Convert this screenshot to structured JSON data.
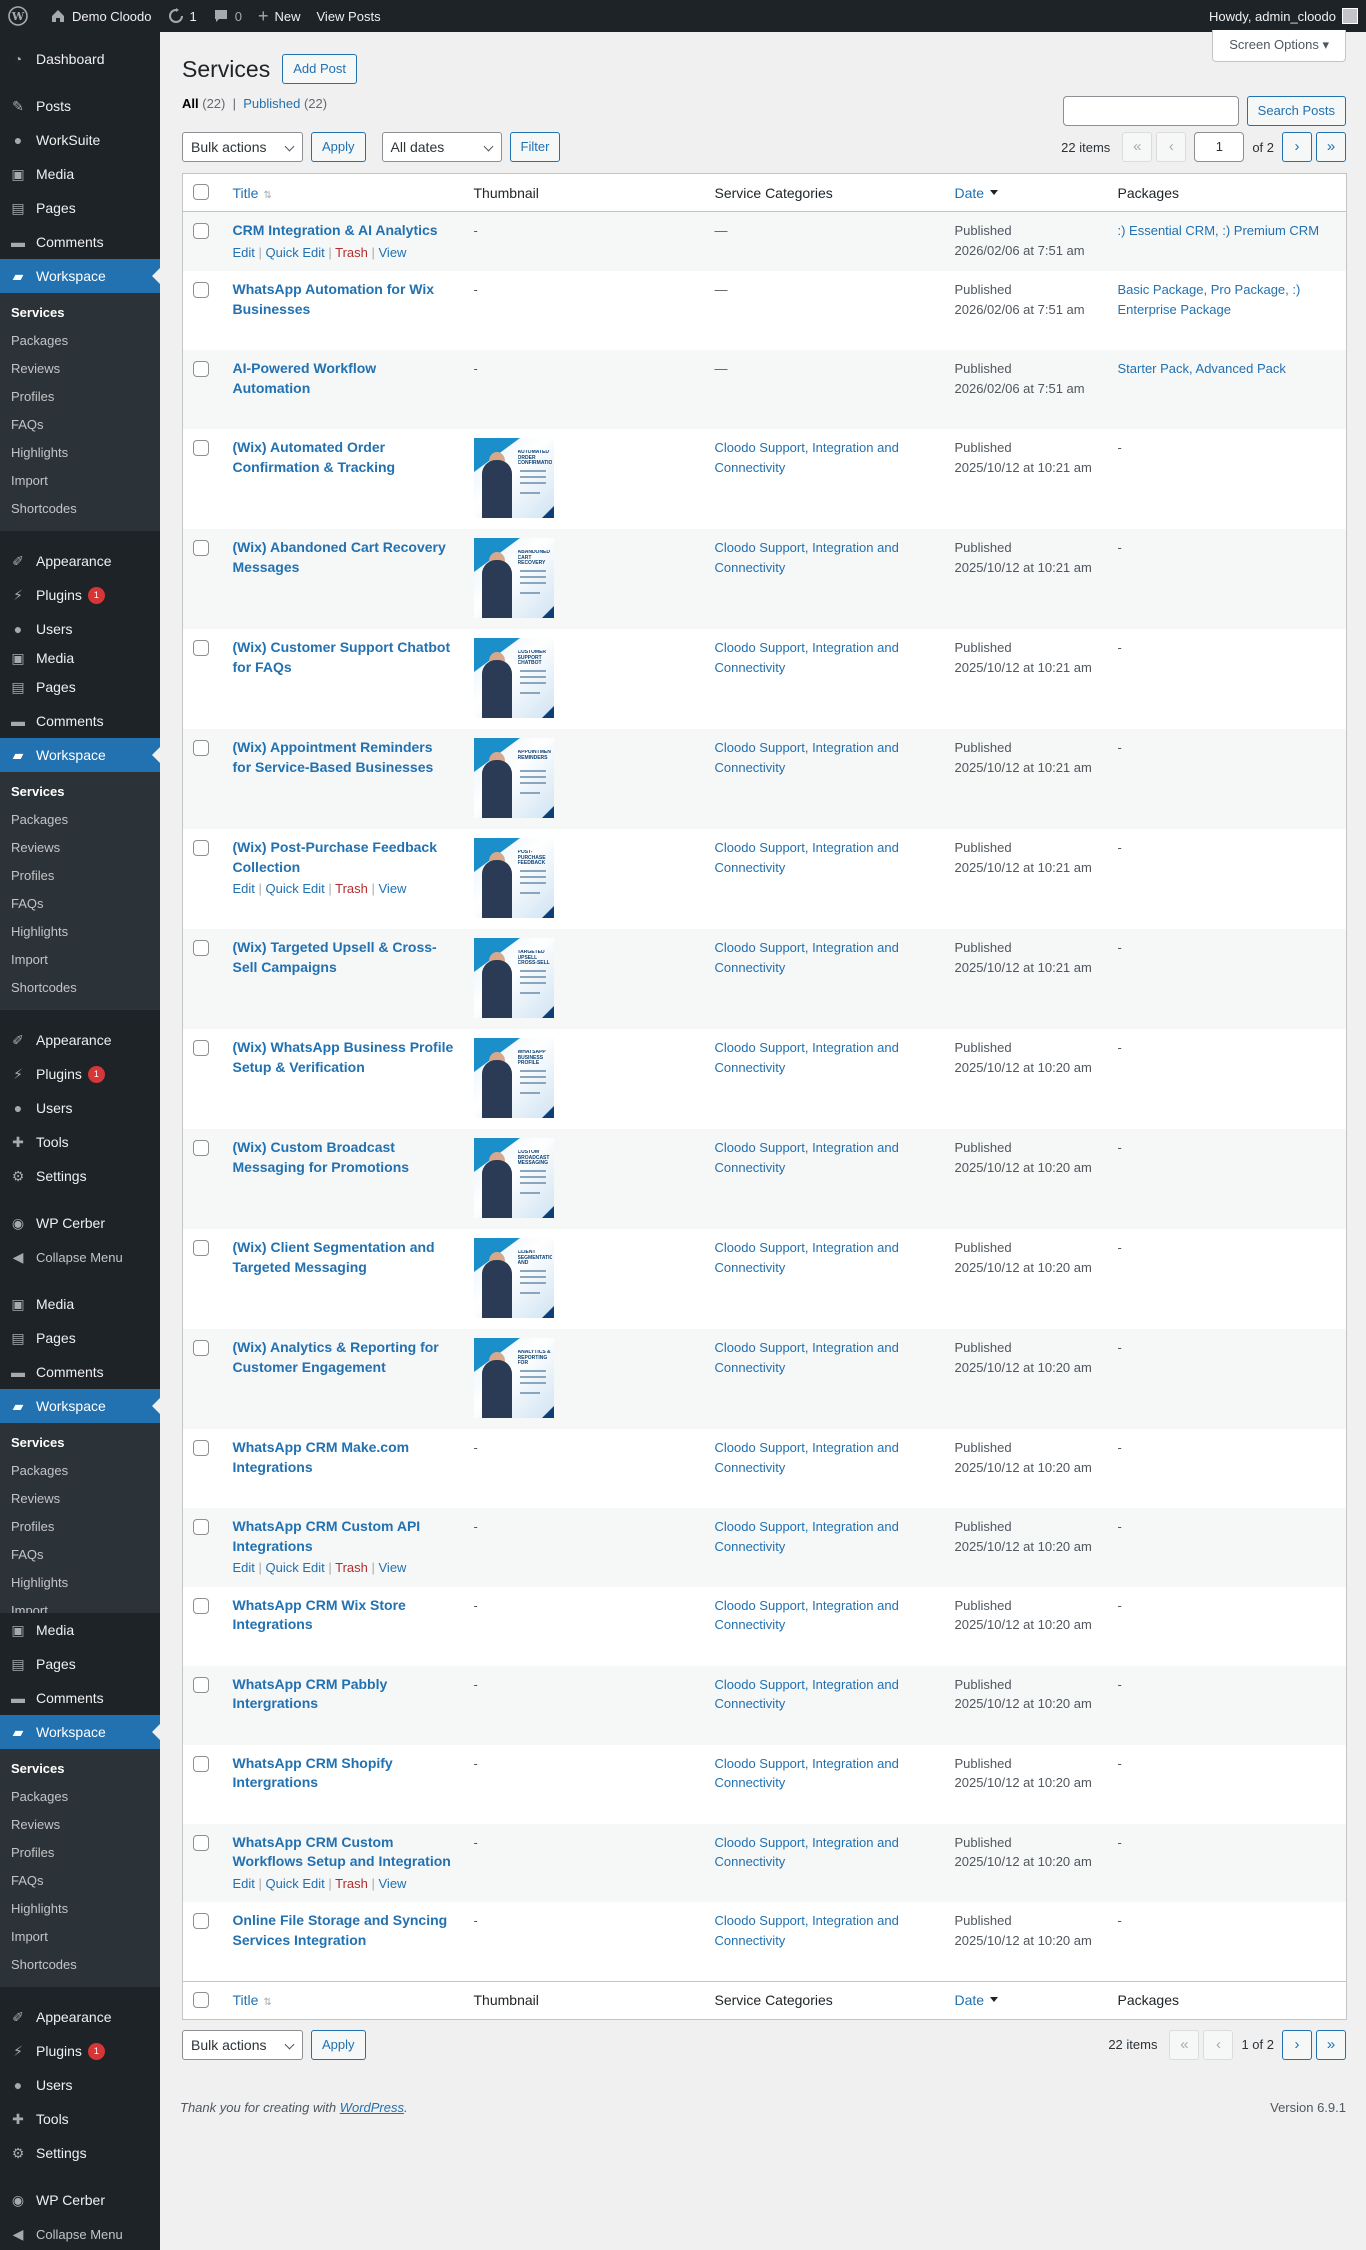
{
  "adminbar": {
    "site": "Demo Cloodo",
    "updates": "1",
    "comments": "0",
    "new": "New",
    "view_posts": "View Posts",
    "howdy": "Howdy, admin_cloodo"
  },
  "menu": {
    "dashboard": "Dashboard",
    "posts": "Posts",
    "worksuite": "WorkSuite",
    "media": "Media",
    "pages": "Pages",
    "comments": "Comments",
    "workspace": "Workspace",
    "sub": [
      "Services",
      "Packages",
      "Reviews",
      "Profiles",
      "FAQs",
      "Highlights",
      "Import",
      "Shortcodes"
    ],
    "appearance": "Appearance",
    "plugins": "Plugins",
    "plugins_badge": "1",
    "users": "Users",
    "tools": "Tools",
    "settings": "Settings",
    "wpcerber": "WP Cerber",
    "collapse": "Collapse Menu"
  },
  "page": {
    "title": "Services",
    "add_post": "Add Post",
    "screen_options": "Screen Options",
    "all": "All",
    "all_count": "(22)",
    "published": "Published",
    "published_count": "(22)",
    "search_button": "Search Posts"
  },
  "filters": {
    "bulk": "Bulk actions",
    "apply": "Apply",
    "dates": "All dates",
    "filter": "Filter",
    "items": "22 items",
    "page": "1",
    "of": "of 2",
    "of_full": "1 of 2",
    "first": "«",
    "prev": "‹",
    "next": "›",
    "last": "»"
  },
  "columns": {
    "title": "Title",
    "thumbnail": "Thumbnail",
    "categories": "Service Categories",
    "date": "Date",
    "packages": "Packages"
  },
  "row_actions": {
    "edit": "Edit",
    "quick": "Quick Edit",
    "trash": "Trash",
    "view": "View"
  },
  "rows": [
    {
      "title": "CRM Integration & AI Analytics",
      "thumb": "-",
      "cat": "—",
      "status": "Published",
      "date": "2026/02/06 at 7:51 am",
      "packages": ":) Essential CRM, :) Premium CRM",
      "actions": true
    },
    {
      "title": "WhatsApp Automation for Wix Businesses",
      "thumb": "-",
      "cat": "—",
      "status": "Published",
      "date": "2026/02/06 at 7:51 am",
      "packages": "Basic Package, Pro Package, :) Enterprise Package"
    },
    {
      "title": "AI-Powered Workflow Automation",
      "thumb": "-",
      "cat": "—",
      "status": "Published",
      "date": "2026/02/06 at 7:51 am",
      "packages": "Starter Pack, Advanced Pack"
    },
    {
      "title": "(Wix) Automated Order Confirmation & Tracking",
      "img": "Automated Order Confirmation Tracking",
      "cat": "Cloodo Support, Integration and Connectivity",
      "status": "Published",
      "date": "2025/10/12 at 10:21 am",
      "packages": "-"
    },
    {
      "title": "(Wix) Abandoned Cart Recovery Messages",
      "img": "Abandoned Cart Recovery Messages",
      "cat": "Cloodo Support, Integration and Connectivity",
      "status": "Published",
      "date": "2025/10/12 at 10:21 am",
      "packages": "-"
    },
    {
      "title": "(Wix) Customer Support Chatbot for FAQs",
      "img": "Customer Support Chatbot for FAQs",
      "cat": "Cloodo Support, Integration and Connectivity",
      "status": "Published",
      "date": "2025/10/12 at 10:21 am",
      "packages": "-"
    },
    {
      "title": "(Wix) Appointment Reminders for Service-Based Businesses",
      "img": "Appointment Reminders",
      "cat": "Cloodo Support, Integration and Connectivity",
      "status": "Published",
      "date": "2025/10/12 at 10:21 am",
      "packages": "-"
    },
    {
      "title": "(Wix) Post-Purchase Feedback Collection",
      "img": "Post-Purchase Feedback Collection",
      "cat": "Cloodo Support, Integration and Connectivity",
      "status": "Published",
      "date": "2025/10/12 at 10:21 am",
      "packages": "-",
      "actions": true
    },
    {
      "title": "(Wix) Targeted Upsell & Cross-Sell Campaigns",
      "img": "Targeted Upsell Cross-Sell Campaigns",
      "cat": "Cloodo Support, Integration and Connectivity",
      "status": "Published",
      "date": "2025/10/12 at 10:21 am",
      "packages": "-"
    },
    {
      "title": "(Wix) WhatsApp Business Profile Setup & Verification",
      "img": "WhatsApp Business Profile Verification",
      "cat": "Cloodo Support, Integration and Connectivity",
      "status": "Published",
      "date": "2025/10/12 at 10:20 am",
      "packages": "-"
    },
    {
      "title": "(Wix) Custom Broadcast Messaging for Promotions",
      "img": "Custom Broadcast Messaging Promotions",
      "cat": "Cloodo Support, Integration and Connectivity",
      "status": "Published",
      "date": "2025/10/12 at 10:20 am",
      "packages": "-"
    },
    {
      "title": "(Wix) Client Segmentation and Targeted Messaging",
      "img": "Client Segmentation and Targeted Messaging",
      "cat": "Cloodo Support, Integration and Connectivity",
      "status": "Published",
      "date": "2025/10/12 at 10:20 am",
      "packages": "-"
    },
    {
      "title": "(Wix) Analytics & Reporting for Customer Engagement",
      "img": "Analytics & Reporting for Customer Engagement",
      "cat": "Cloodo Support, Integration and Connectivity",
      "status": "Published",
      "date": "2025/10/12 at 10:20 am",
      "packages": "-"
    },
    {
      "title": "WhatsApp CRM Make.com Integrations",
      "thumb": "-",
      "cat": "Cloodo Support, Integration and Connectivity",
      "status": "Published",
      "date": "2025/10/12 at 10:20 am",
      "packages": "-"
    },
    {
      "title": "WhatsApp CRM Custom API Integrations",
      "thumb": "-",
      "cat": "Cloodo Support, Integration and Connectivity",
      "status": "Published",
      "date": "2025/10/12 at 10:20 am",
      "packages": "-",
      "actions": true
    },
    {
      "title": "WhatsApp CRM Wix Store Integrations",
      "thumb": "-",
      "cat": "Cloodo Support, Integration and Connectivity",
      "status": "Published",
      "date": "2025/10/12 at 10:20 am",
      "packages": "-"
    },
    {
      "title": "WhatsApp CRM Pabbly Intergrations",
      "thumb": "-",
      "cat": "Cloodo Support, Integration and Connectivity",
      "status": "Published",
      "date": "2025/10/12 at 10:20 am",
      "packages": "-"
    },
    {
      "title": "WhatsApp CRM Shopify Intergrations",
      "thumb": "-",
      "cat": "Cloodo Support, Integration and Connectivity",
      "status": "Published",
      "date": "2025/10/12 at 10:20 am",
      "packages": "-"
    },
    {
      "title": "WhatsApp CRM Custom Workflows Setup and Integration",
      "thumb": "-",
      "cat": "Cloodo Support, Integration and Connectivity",
      "status": "Published",
      "date": "2025/10/12 at 10:20 am",
      "packages": "-",
      "actions": true
    },
    {
      "title": "Online File Storage and Syncing Services Integration",
      "thumb": "-",
      "cat": "Cloodo Support, Integration and Connectivity",
      "status": "Published",
      "date": "2025/10/12 at 10:20 am",
      "packages": "-"
    }
  ],
  "footer": {
    "thanks": "Thank you for creating with",
    "wp": "WordPress",
    "version": "Version 6.9.1"
  }
}
